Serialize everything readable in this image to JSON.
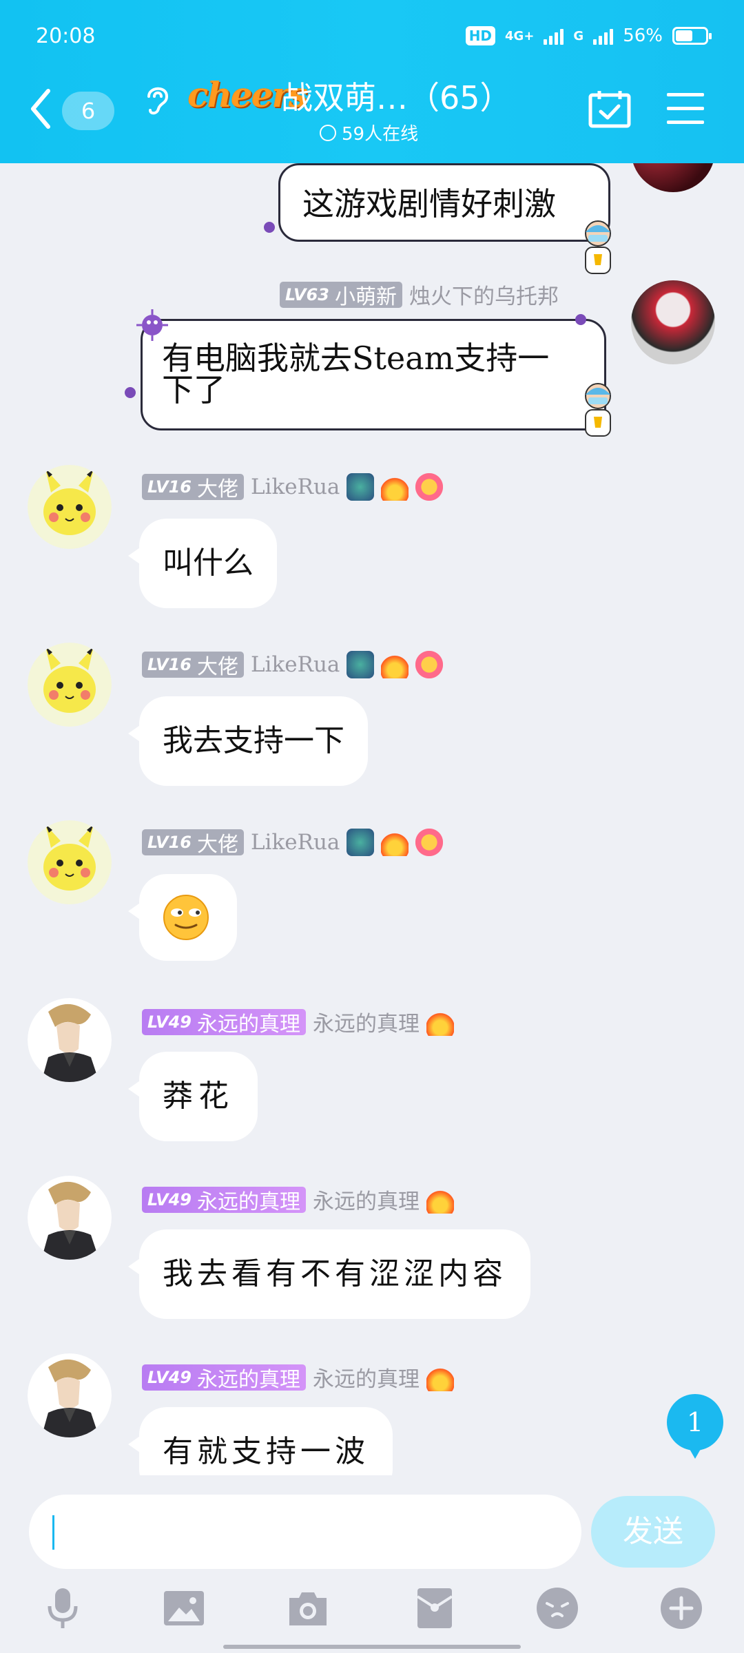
{
  "status_bar": {
    "time": "20:08",
    "hd": "HD",
    "network": "4G+",
    "network2": "G",
    "battery": "56%"
  },
  "header": {
    "unread_count": "6",
    "logo_text": "cheers",
    "title": "战双萌…（65）",
    "online": "59人在线"
  },
  "messages": [
    {
      "level": "",
      "rank": "",
      "nickname": "",
      "text": "这游戏剧情好刺激"
    },
    {
      "level": "LV63",
      "rank": "小萌新",
      "nickname": "烛火下的乌托邦",
      "text_line1": "有电脑我就去Steam支持一",
      "text_line2": "下了"
    },
    {
      "level": "LV16",
      "rank": "大佬",
      "nickname": "LikeRua",
      "text": "叫什么"
    },
    {
      "level": "LV16",
      "rank": "大佬",
      "nickname": "LikeRua",
      "text": "我去支持一下"
    },
    {
      "level": "LV16",
      "rank": "大佬",
      "nickname": "LikeRua",
      "text": ""
    },
    {
      "level": "LV49",
      "rank": "永远的真理",
      "nickname": "永远的真理",
      "text": "莽花"
    },
    {
      "level": "LV49",
      "rank": "永远的真理",
      "nickname": "永远的真理",
      "text": "我去看有不有涩涩内容"
    },
    {
      "level": "LV49",
      "rank": "永远的真理",
      "nickname": "永远的真理",
      "text": "有就支持一波"
    }
  ],
  "new_message_count": "1",
  "composer": {
    "send_label": "发送"
  },
  "colors": {
    "accent": "#16c1f2",
    "background": "#eef0f5",
    "purple_tag": "#c98af5",
    "gray_tag": "#a9acb9"
  }
}
